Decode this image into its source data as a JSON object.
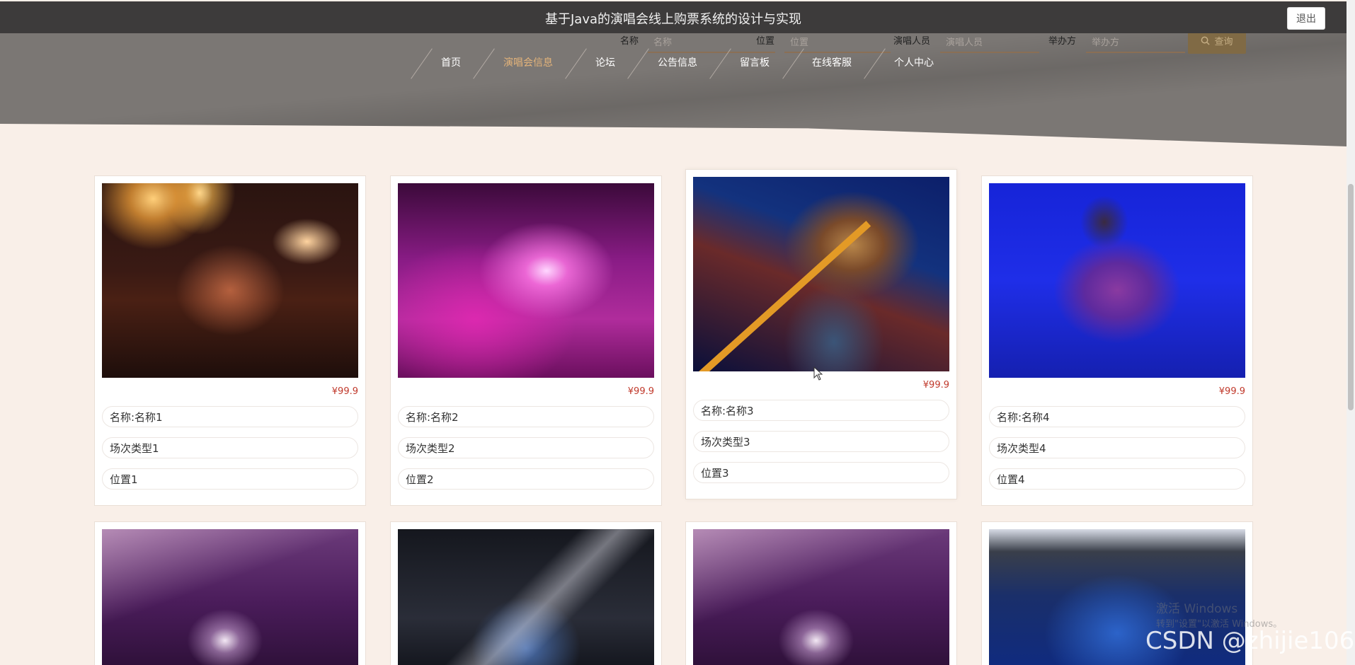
{
  "header": {
    "title": "基于Java的演唱会线上购票系统的设计与实现",
    "logout_label": "退出"
  },
  "search": {
    "fields": [
      {
        "label": "名称",
        "placeholder": "名称"
      },
      {
        "label": "位置",
        "placeholder": "位置"
      },
      {
        "label": "演唱人员",
        "placeholder": "演唱人员"
      },
      {
        "label": "举办方",
        "placeholder": "举办方"
      }
    ],
    "button_label": "查询",
    "button_icon": "search-icon"
  },
  "nav": {
    "items": [
      {
        "label": "首页",
        "active": false
      },
      {
        "label": "演唱会信息",
        "active": true
      },
      {
        "label": "论坛",
        "active": false
      },
      {
        "label": "公告信息",
        "active": false
      },
      {
        "label": "留言板",
        "active": false
      },
      {
        "label": "在线客服",
        "active": false
      },
      {
        "label": "个人中心",
        "active": false
      }
    ],
    "active_color": "#e3b37a"
  },
  "cards": [
    {
      "price": "¥99.9",
      "name": "名称:名称1",
      "type": "场次类型1",
      "location": "位置1"
    },
    {
      "price": "¥99.9",
      "name": "名称:名称2",
      "type": "场次类型2",
      "location": "位置2"
    },
    {
      "price": "¥99.9",
      "name": "名称:名称3",
      "type": "场次类型3",
      "location": "位置3"
    },
    {
      "price": "¥99.9",
      "name": "名称:名称4",
      "type": "场次类型4",
      "location": "位置4"
    }
  ],
  "overlays": {
    "windows_activation_1": "激活 Windows",
    "windows_activation_2": "转到\"设置\"以激活 Windows。",
    "csdn_watermark": "CSDN @zhijie106"
  },
  "colors": {
    "price": "#c0392b",
    "titlebar": "#3d3b3b",
    "search_button": "#806a45",
    "page_background": "#f9efe8"
  }
}
